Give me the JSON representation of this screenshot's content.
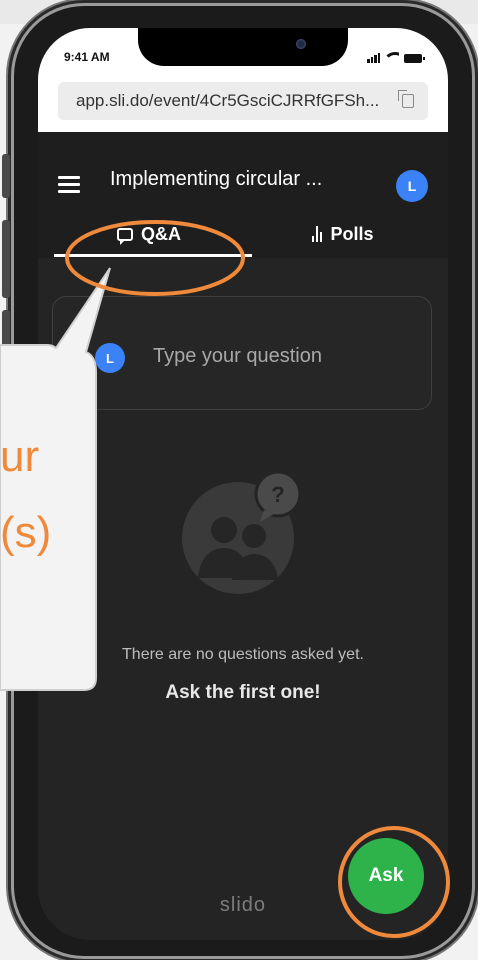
{
  "status_bar": {
    "time": "9:41 AM"
  },
  "browser": {
    "url": "app.sli.do/event/4Cr5GsciCJRRfGFSh..."
  },
  "header": {
    "title": "Implementing circular ...",
    "avatar_initial": "L"
  },
  "tabs": [
    {
      "label": "Q&A",
      "active": true
    },
    {
      "label": "Polls",
      "active": false
    }
  ],
  "question_input": {
    "avatar_initial": "L",
    "placeholder": "Type your question"
  },
  "empty_state": {
    "illustration_glyph": "?",
    "line1": "There are no questions asked yet.",
    "line2": "Ask the first one!"
  },
  "brand": {
    "logo_text": "slido"
  },
  "ask_button": {
    "label": "Ask"
  },
  "annotation": {
    "callout_line1": "ur",
    "callout_line2": "(s)",
    "color": "#ef8a3c"
  },
  "colors": {
    "accent_blue": "#3b82f6",
    "ask_green": "#2db34a",
    "background_dark": "#242424"
  }
}
